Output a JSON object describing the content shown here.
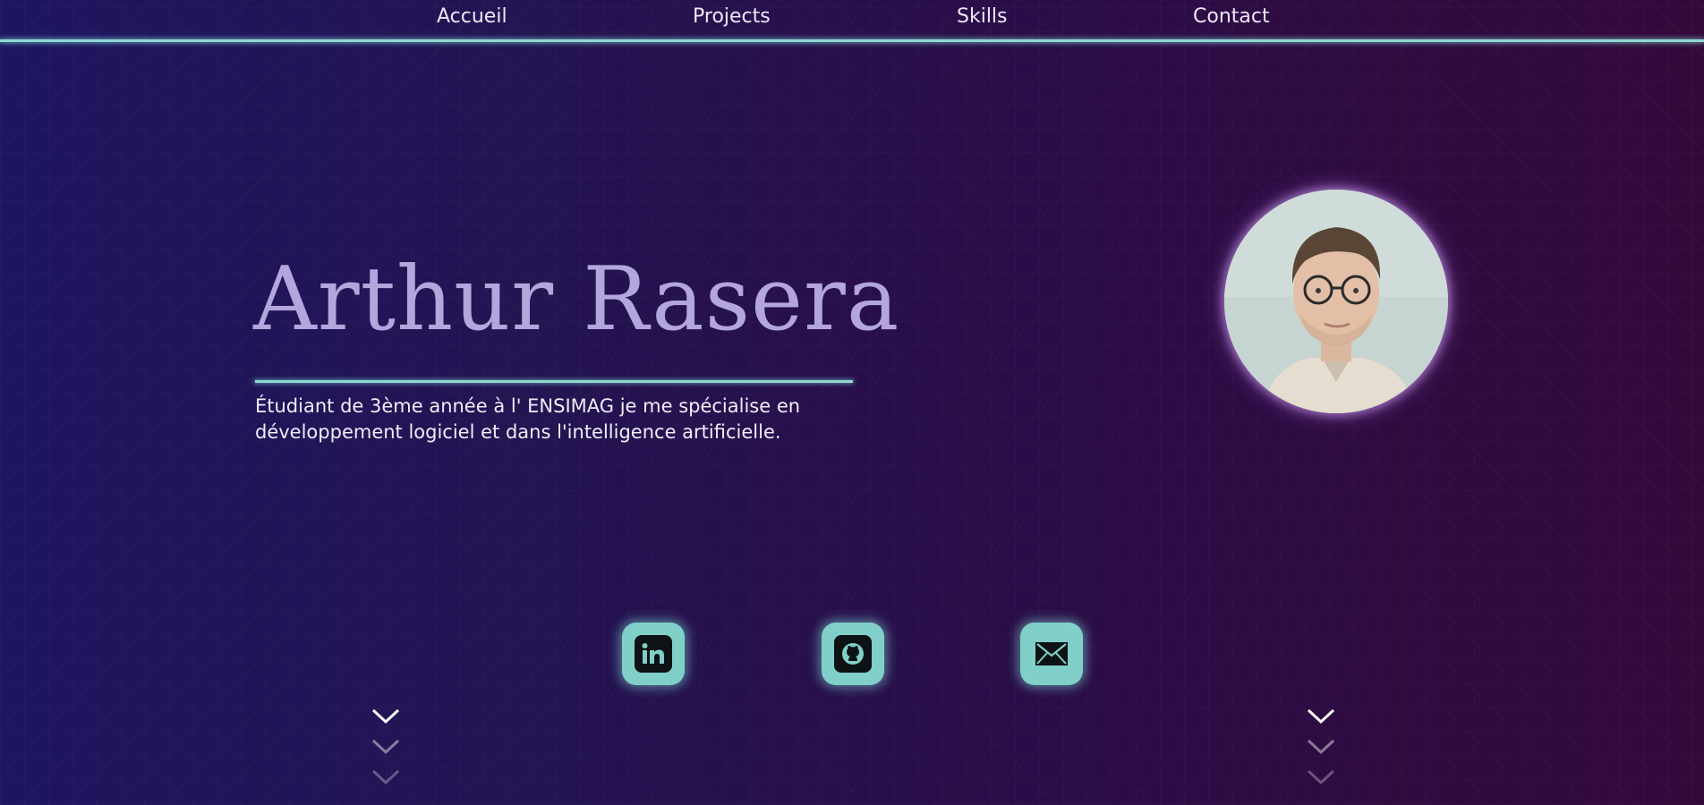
{
  "nav": {
    "items": [
      {
        "label": "Accueil"
      },
      {
        "label": "Projects"
      },
      {
        "label": "Skills"
      },
      {
        "label": "Contact"
      }
    ]
  },
  "hero": {
    "name": "Arthur Rasera",
    "bio_line1": "Étudiant de 3ème année à l' ENSIMAG je me spécialise en",
    "bio_line2": "développement logiciel et dans l'intelligence artificielle."
  },
  "social": [
    {
      "icon": "linkedin-icon"
    },
    {
      "icon": "github-icon"
    },
    {
      "icon": "mail-icon"
    }
  ],
  "colors": {
    "accent": "#8fd8d2",
    "name_color": "#b3a6dc",
    "button_bg": "#80cfc8",
    "bg_left": "#1e1560",
    "bg_right": "#33093a"
  }
}
